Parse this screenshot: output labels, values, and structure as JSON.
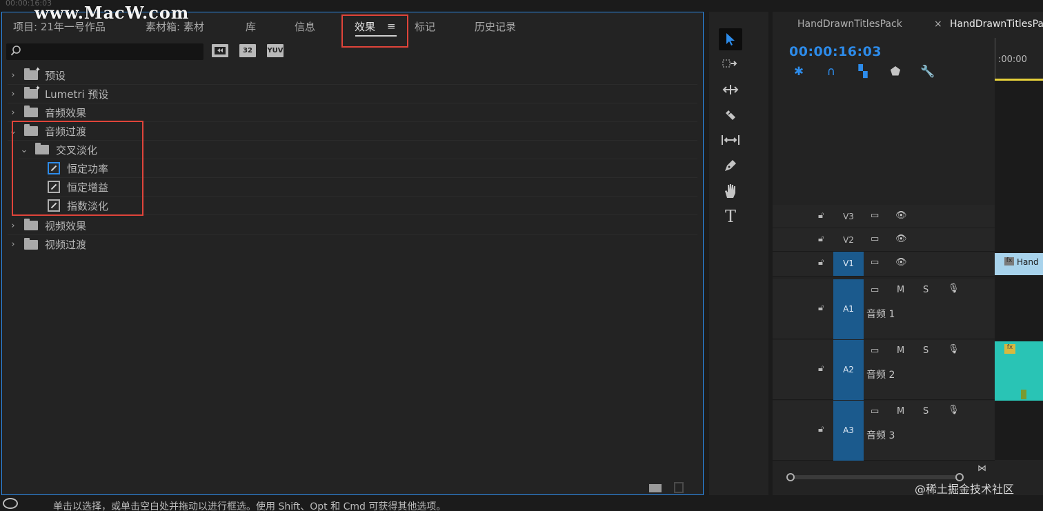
{
  "watermarks": {
    "top_timecode": "00:00:16:03",
    "site": "www.MacW.com",
    "juejin": "@稀土掘金技术社区"
  },
  "effects_panel": {
    "tabs": [
      "项目: 21年一号作品",
      "素材箱: 素材",
      "库",
      "信息",
      "效果",
      "标记",
      "历史记录"
    ],
    "active_tab": "效果",
    "menu_glyph": "≡",
    "toolbar_buttons": [
      "32",
      "YUV"
    ],
    "tree": [
      {
        "label": "预设",
        "expanded": false
      },
      {
        "label": "Lumetri 预设",
        "expanded": false
      },
      {
        "label": "音频效果",
        "expanded": false
      },
      {
        "label": "音频过渡",
        "expanded": true
      },
      {
        "label": "交叉淡化",
        "expanded": true
      },
      {
        "label": "恒定功率"
      },
      {
        "label": "恒定增益"
      },
      {
        "label": "指数淡化"
      },
      {
        "label": "视频效果",
        "expanded": false
      },
      {
        "label": "视频过渡",
        "expanded": false
      }
    ],
    "chevron_collapsed": "›",
    "chevron_expanded": "⌄"
  },
  "tools": [
    "selection-tool",
    "track-select-tool",
    "ripple-edit-tool",
    "razor-tool",
    "slip-tool",
    "pen-tool",
    "hand-tool",
    "type-tool"
  ],
  "timeline": {
    "tabs": [
      "HandDrawnTitlesPack",
      "HandDrawnTitlesPac"
    ],
    "close_glyph": "×",
    "timecode": "00:00:16:03",
    "ruler_label": ":00:00",
    "video_tracks": [
      {
        "name": "V3"
      },
      {
        "name": "V2"
      },
      {
        "name": "V1",
        "targeted": true
      }
    ],
    "audio_tracks": [
      {
        "name": "A1",
        "label": "音频 1"
      },
      {
        "name": "A2",
        "label": "音频 2"
      },
      {
        "name": "A3",
        "label": "音频 3"
      }
    ],
    "mute_label": "M",
    "solo_label": "S",
    "clip_label": "Hand",
    "fx_label": "fx",
    "accent_color": "#2d8ceb",
    "audio_clip_color": "#29c4b5",
    "video_clip_color": "#a8d3ec"
  },
  "status_bar": {
    "text": "单击以选择，或单击空白处并拖动以进行框选。使用 Shift、Opt 和 Cmd 可获得其他选项。"
  }
}
